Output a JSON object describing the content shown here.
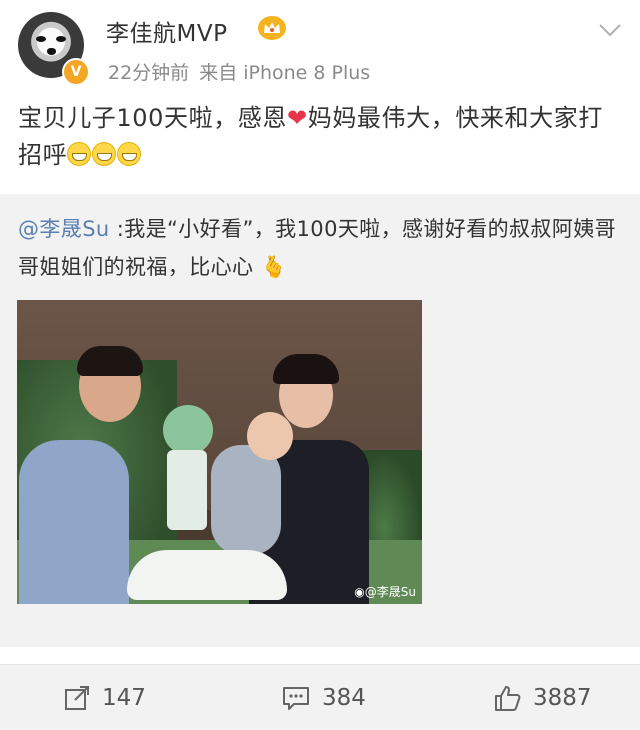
{
  "post": {
    "username": "李佳航MVP",
    "verified_mark": "V",
    "time": "22分钟前",
    "source": "来自 iPhone 8 Plus",
    "text_part1": "宝贝儿子100天啦，感恩",
    "heart": "❤",
    "text_part2": "妈妈最伟大，快来和大家打招呼"
  },
  "repost": {
    "mention": "@李晟Su",
    "text": " :我是“小好看”，我100天啦，感谢好看的叔叔阿姨哥哥姐姐们的祝福，比心心",
    "photo_watermark": "@李晟Su"
  },
  "actions": {
    "reposts": "147",
    "comments": "384",
    "likes": "3887"
  },
  "icons": {
    "avatar": "husky-avatar",
    "badge": "verified-v-icon",
    "vip": "crown-icon",
    "menu": "chevron-down-icon",
    "repost": "share-icon",
    "comment": "comment-icon",
    "like": "thumbs-up-icon"
  },
  "colors": {
    "mention": "#5a7fb0",
    "badge": "#f5a623",
    "heart": "#e6344a",
    "repost_bg": "#f2f2f2"
  }
}
